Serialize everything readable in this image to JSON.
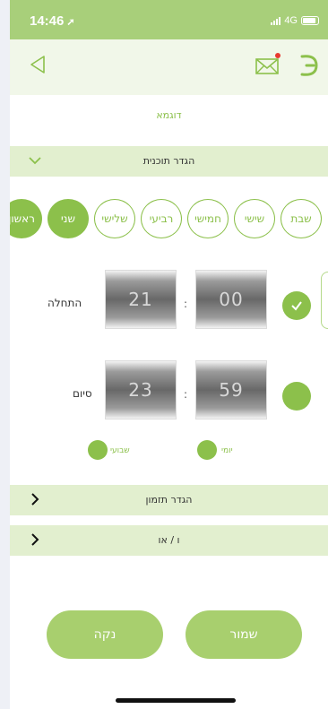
{
  "status": {
    "time": "14:46",
    "network": "4G"
  },
  "header": {
    "back_icon": "triangle-left-icon",
    "mail_icon": "envelope-icon",
    "menu_icon": "menu-icon"
  },
  "example_label": "דוגמא",
  "program_section": {
    "title": "הגדר תוכנית"
  },
  "days": [
    {
      "label": "ראשון",
      "selected": true
    },
    {
      "label": "שני",
      "selected": true
    },
    {
      "label": "שלישי",
      "selected": false
    },
    {
      "label": "רביעי",
      "selected": false
    },
    {
      "label": "חמישי",
      "selected": false
    },
    {
      "label": "שישי",
      "selected": false
    },
    {
      "label": "שבת",
      "selected": false
    }
  ],
  "start": {
    "label": "התחלה",
    "hour": "21",
    "minute": "00",
    "separator": ":"
  },
  "end": {
    "label": "סיום",
    "hour": "23",
    "minute": "59",
    "separator": ":"
  },
  "frequency": {
    "weekly": "שבועי",
    "daily": "יומי"
  },
  "timer_section": {
    "title": "הגדר תזמון"
  },
  "andor_section": {
    "title": "ו / או"
  },
  "buttons": {
    "save": "שמור",
    "clear": "נקה"
  },
  "colors": {
    "accent": "#8cc04b",
    "section_bg": "#e2efcf",
    "button": "#a8cf6e"
  }
}
